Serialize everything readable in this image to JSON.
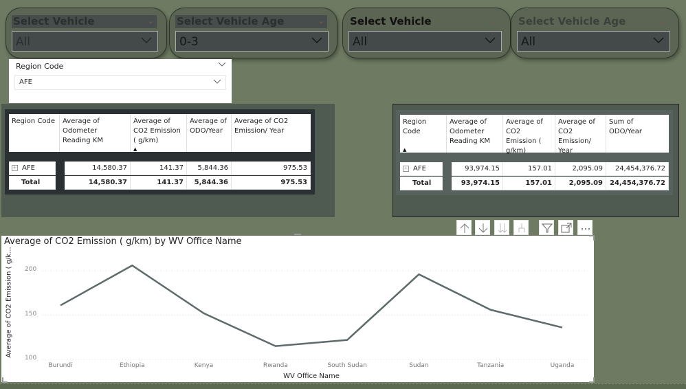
{
  "slicers": [
    {
      "title": "Select Vehicle",
      "value": "All"
    },
    {
      "title": "Select Vehicle Age",
      "value": "0-3"
    },
    {
      "title": "Select Vehicle",
      "value": "All"
    },
    {
      "title": "Select Vehicle Age",
      "value": "All"
    }
  ],
  "region_slicer": {
    "label": "Region Code",
    "value": "AFE"
  },
  "table_left": {
    "headers": [
      "Region Code",
      "Average of Odometer Reading KM",
      "Average of CO2 Emission ( g/km)",
      "Average of ODO/Year",
      "Average of CO2 Emission/ Year"
    ],
    "rows": [
      {
        "region": "AFE",
        "values": [
          "14,580.37",
          "141.37",
          "5,844.36",
          "975.53"
        ]
      },
      {
        "region": "Total",
        "values": [
          "14,580.37",
          "141.37",
          "5,844.36",
          "975.53"
        ]
      }
    ]
  },
  "table_right": {
    "headers": [
      "Region Code",
      "Average of Odometer Reading KM",
      "Average of CO2 Emission ( g/km)",
      "Average of CO2 Emission/ Year",
      "Sum of ODO/Year"
    ],
    "rows": [
      {
        "region": "AFE",
        "values": [
          "93,974.15",
          "157.01",
          "2,095.09",
          "24,454,376.72"
        ]
      },
      {
        "region": "Total",
        "values": [
          "93,974.15",
          "157.01",
          "2,095.09",
          "24,454,376.72"
        ]
      }
    ]
  },
  "visual_toolbar": [
    "arrow-up-icon",
    "arrow-down-icon",
    "double-arrow-down-icon",
    "expand-hierarchy-icon",
    "filter-icon",
    "focus-mode-icon",
    "more-options-icon"
  ],
  "chart_data": {
    "type": "line",
    "title": "Average of CO2 Emission ( g/km) by WV Office Name",
    "xlabel": "WV Office Name",
    "ylabel": "Average of CO2 Emission ( g/k...",
    "categories": [
      "Burundi",
      "Ethiopia",
      "Kenya",
      "Rwanda",
      "South Sudan",
      "Sudan",
      "Tanzania",
      "Uganda"
    ],
    "series": [
      {
        "name": "Average of CO2 Emission ( g/km)",
        "values": [
          161,
          206,
          152,
          115,
          122,
          196,
          156,
          136
        ]
      }
    ],
    "yticks": [
      100,
      150,
      200
    ],
    "ylim": [
      100,
      200
    ],
    "grid": true,
    "line_color": "#5f6b6b"
  }
}
